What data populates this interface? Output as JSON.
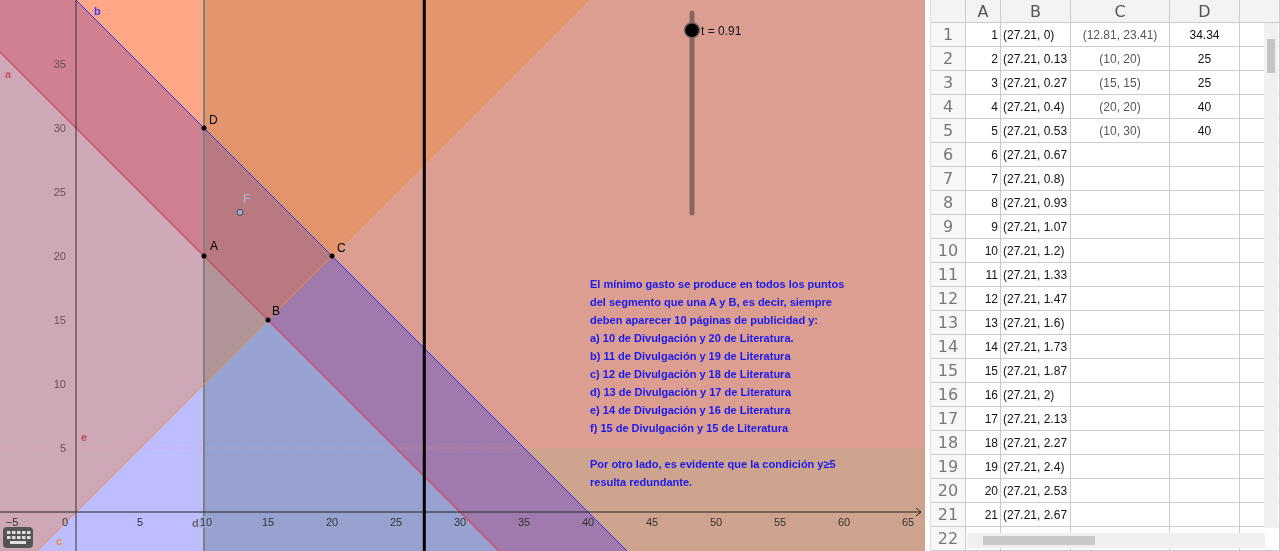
{
  "graph": {
    "x_ticks": [
      "−5",
      "0",
      "5",
      "10",
      "15",
      "20",
      "25",
      "30",
      "35",
      "40",
      "45",
      "50",
      "55",
      "60",
      "65"
    ],
    "y_ticks": [
      "35",
      "30",
      "25",
      "20",
      "15",
      "10",
      "5"
    ],
    "line_labels": [
      {
        "label": "a"
      },
      {
        "label": "b"
      },
      {
        "label": "c"
      },
      {
        "label": "d"
      },
      {
        "label": "e"
      }
    ],
    "points": [
      {
        "label": "A"
      },
      {
        "label": "B"
      },
      {
        "label": "C"
      },
      {
        "label": "D"
      },
      {
        "label": "F"
      }
    ],
    "slider": {
      "label": "t = 0.91",
      "level": 0.91
    },
    "note": {
      "paragraphs": [
        [
          "El mínimo gasto se produce en todos los puntos",
          "del segmento que una A y B, es decir, siempre",
          "deben aparecer 10 páginas de publicidad y:",
          "a) 10 de Divulgación y 20 de Literatura.",
          "b) 11 de Divulgación y 19 de Literatura",
          "c) 12 de Divulgación y 18 de Literatura",
          "d) 13 de Divulgación y 17 de Literatura",
          "e) 14 de Divulgación y 16 de Literatura",
          "f) 15 de Divulgación y 15 de Literatura"
        ],
        [
          "Por otro lado, es evidente que la condición y≥5",
          "resulta redundante."
        ]
      ]
    }
  },
  "spreadsheet": {
    "columns": [
      "A",
      "B",
      "C",
      "D"
    ],
    "rows": [
      {
        "header": "1",
        "cells": [
          "1",
          "(27.21, 0)",
          "(12.81, 23.41)",
          "34.34"
        ]
      },
      {
        "header": "2",
        "cells": [
          "2",
          "(27.21, 0.13",
          "(10, 20)",
          "25"
        ]
      },
      {
        "header": "3",
        "cells": [
          "3",
          "(27.21, 0.27",
          "(15, 15)",
          "25"
        ]
      },
      {
        "header": "4",
        "cells": [
          "4",
          "(27.21, 0.4)",
          "(20, 20)",
          "40"
        ]
      },
      {
        "header": "5",
        "cells": [
          "5",
          "(27.21, 0.53",
          "(10, 30)",
          "40"
        ]
      },
      {
        "header": "6",
        "cells": [
          "6",
          "(27.21, 0.67"
        ]
      },
      {
        "header": "7",
        "cells": [
          "7",
          "(27.21, 0.8)"
        ]
      },
      {
        "header": "8",
        "cells": [
          "8",
          "(27.21, 0.93"
        ]
      },
      {
        "header": "9",
        "cells": [
          "9",
          "(27.21, 1.07"
        ]
      },
      {
        "header": "10",
        "cells": [
          "10",
          "(27.21, 1.2)"
        ]
      },
      {
        "header": "11",
        "cells": [
          "11",
          "(27.21, 1.33"
        ]
      },
      {
        "header": "12",
        "cells": [
          "12",
          "(27.21, 1.47"
        ]
      },
      {
        "header": "13",
        "cells": [
          "13",
          "(27.21, 1.6)"
        ]
      },
      {
        "header": "14",
        "cells": [
          "14",
          "(27.21, 1.73"
        ]
      },
      {
        "header": "15",
        "cells": [
          "15",
          "(27.21, 1.87"
        ]
      },
      {
        "header": "16",
        "cells": [
          "16",
          "(27.21, 2)"
        ]
      },
      {
        "header": "17",
        "cells": [
          "17",
          "(27.21, 2.13"
        ]
      },
      {
        "header": "18",
        "cells": [
          "18",
          "(27.21, 2.27"
        ]
      },
      {
        "header": "19",
        "cells": [
          "19",
          "(27.21, 2.4)"
        ]
      },
      {
        "header": "20",
        "cells": [
          "20",
          "(27.21, 2.53"
        ]
      },
      {
        "header": "21",
        "cells": [
          "21",
          "(27.21, 2.67"
        ]
      },
      {
        "header": "22"
      }
    ]
  }
}
